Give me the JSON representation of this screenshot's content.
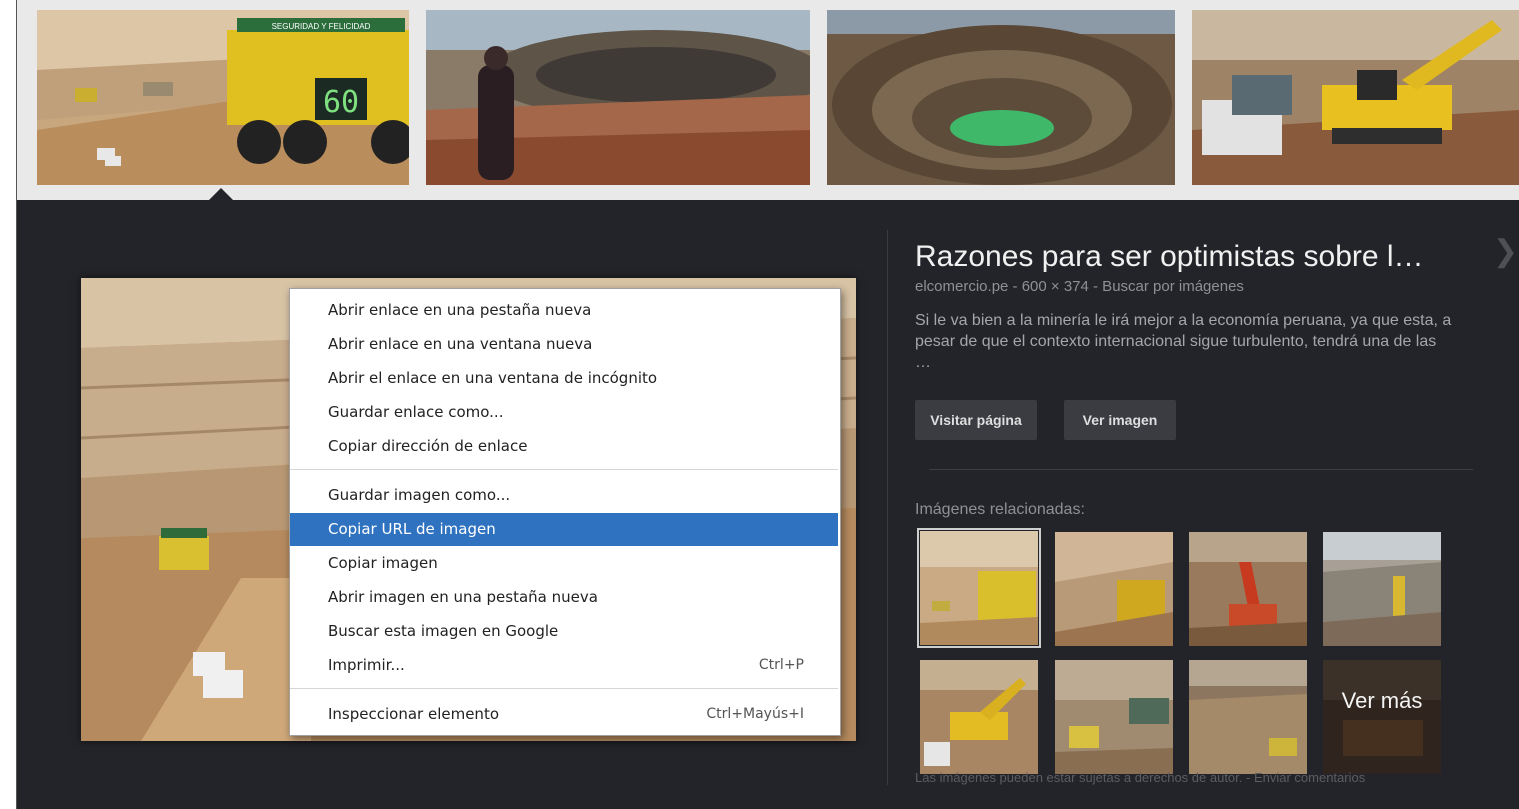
{
  "colors": {
    "panel_bg": "#232429",
    "strip_bg": "#e9e9e9",
    "highlight": "#2f72c0",
    "title": "#f1f1f1",
    "muted": "#8f9096"
  },
  "thumbnail_strip": {
    "images": [
      {
        "icon": "mining-truck-photo",
        "truck_sign": "SEGURIDAD Y FELICIDAD",
        "truck_number": "60"
      },
      {
        "icon": "woman-at-open-pit-photo"
      },
      {
        "icon": "open-pit-green-lake-photo"
      },
      {
        "icon": "excavator-and-trucks-photo"
      }
    ]
  },
  "context_menu": {
    "items": [
      {
        "label": "Abrir enlace en una pestaña nueva",
        "shortcut": ""
      },
      {
        "label": "Abrir enlace en una ventana nueva",
        "shortcut": ""
      },
      {
        "label": "Abrir el enlace en una ventana de incógnito",
        "shortcut": ""
      },
      {
        "label": "Guardar enlace como...",
        "shortcut": ""
      },
      {
        "label": "Copiar dirección de enlace",
        "shortcut": ""
      },
      {
        "label": "Guardar imagen como...",
        "shortcut": ""
      },
      {
        "label": "Copiar URL de imagen",
        "shortcut": "",
        "highlighted": true
      },
      {
        "label": "Copiar imagen",
        "shortcut": ""
      },
      {
        "label": "Abrir imagen en una pestaña nueva",
        "shortcut": ""
      },
      {
        "label": "Buscar esta imagen en Google",
        "shortcut": ""
      },
      {
        "label": "Imprimir...",
        "shortcut": "Ctrl+P"
      },
      {
        "label": "Inspeccionar elemento",
        "shortcut": "Ctrl+Mayús+I"
      }
    ]
  },
  "info_panel": {
    "title": "Razones para ser optimistas sobre l…",
    "meta": "elcomercio.pe - 600 × 374 - Buscar por imágenes",
    "description": "Si le va bien a la minería le irá mejor a la economía peruana, ya que esta, a pesar de que el contexto internacional sigue turbulento, tendrá una de las …",
    "buttons": {
      "visit": "Visitar página",
      "view": "Ver imagen"
    },
    "related_title": "Imágenes relacionadas:",
    "see_more": "Ver más",
    "footer_text": "Las imágenes pueden estar sujetas a derechos de autor.",
    "footer_sep": " - ",
    "footer_link": "Enviar comentarios",
    "close_icon": "close-chevron-icon"
  }
}
